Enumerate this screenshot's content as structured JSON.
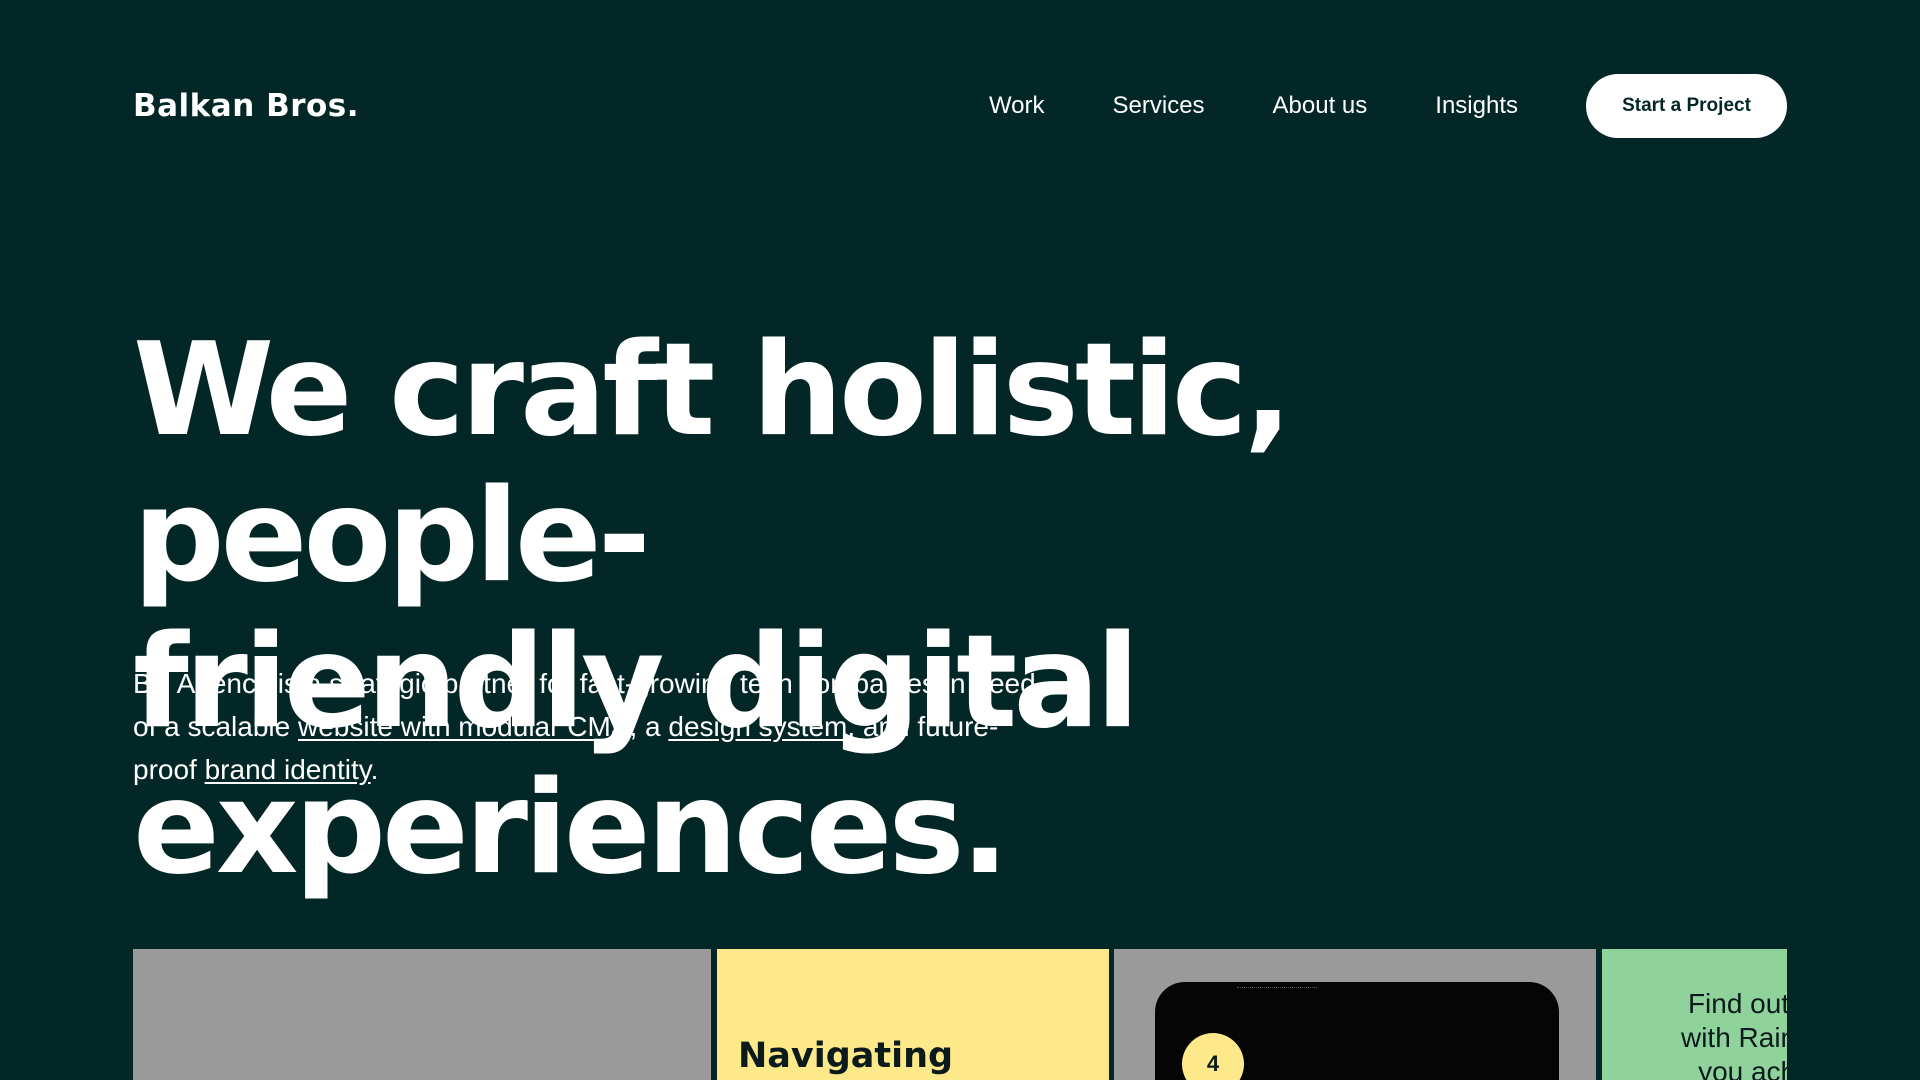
{
  "header": {
    "logo": "Balkan Bros.",
    "nav": [
      "Work",
      "Services",
      "About us",
      "Insights"
    ],
    "cta": "Start a Project"
  },
  "hero": {
    "headline_line1": "We craft holistic, people-",
    "headline_line2": "friendly digital experiences.",
    "intro": {
      "t1": "BB Agency is a strategic partner for fast-growing tech companies in need of a scalable ",
      "link1": "website with modular CMS",
      "t2": ", a ",
      "link2": "design system",
      "t3": ", and future-proof ",
      "link3": "brand identity",
      "t4": "."
    }
  },
  "cards": {
    "card2_title": "Navigating",
    "card3_badge": "4",
    "card4_lines": [
      "Find out ho",
      "with Rainma",
      "you achie"
    ]
  },
  "colors": {
    "background": "#032727",
    "text": "#ffffff",
    "cta_bg": "#ffffff",
    "card_gray": "#9a9a9a",
    "card_yellow": "#fde989",
    "card_green": "#8fd29c"
  }
}
